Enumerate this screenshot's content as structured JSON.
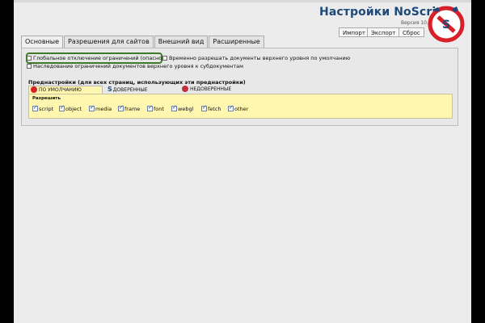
{
  "app": {
    "title": "Настройки NoScript",
    "version": "Версия 10.2.4"
  },
  "toolbar": {
    "import_label": "Импорт",
    "export_label": "Экспорт",
    "reset_label": "Сброс"
  },
  "tabs": [
    {
      "label": "Основные",
      "active": true
    },
    {
      "label": "Разрешения для сайтов",
      "active": false
    },
    {
      "label": "Внешний вид",
      "active": false
    },
    {
      "label": "Расширенные",
      "active": false
    }
  ],
  "general": {
    "global_disable_label": "Глобальное отключение ограничений (опасно)",
    "global_disable_checked": false,
    "temp_allow_label": "Временно разрешать документы верхнего уровня по умолчанию",
    "temp_allow_checked": false,
    "cascade_label": "Наследование ограничений документов верхнего уровня к субдокументам",
    "cascade_checked": false
  },
  "presets": {
    "title": "Преднастройки (для всех страниц, использующих эти преднастройки)",
    "tabs": [
      {
        "label": "ПО УМОЛЧАНИЮ",
        "icon": "default-preset-icon",
        "active": true
      },
      {
        "label": "ДОВЕРЕННЫЕ",
        "icon": "trusted-s-icon",
        "active": false
      },
      {
        "label": "НЕДОВЕРЕННЫЕ",
        "icon": "untrusted-icon",
        "active": false
      }
    ],
    "allow_label": "Разрешить",
    "permissions": [
      {
        "label": "script",
        "checked": true
      },
      {
        "label": "object",
        "checked": true
      },
      {
        "label": "media",
        "checked": true
      },
      {
        "label": "frame",
        "checked": true
      },
      {
        "label": "font",
        "checked": true
      },
      {
        "label": "webgl",
        "checked": true
      },
      {
        "label": "fetch",
        "checked": true
      },
      {
        "label": "other",
        "checked": true
      }
    ]
  },
  "colors": {
    "title": "#1e4a7a",
    "highlight_border": "#3d7a2a",
    "preset_bg": "#fff7b0",
    "logo_red": "#d8202a"
  }
}
